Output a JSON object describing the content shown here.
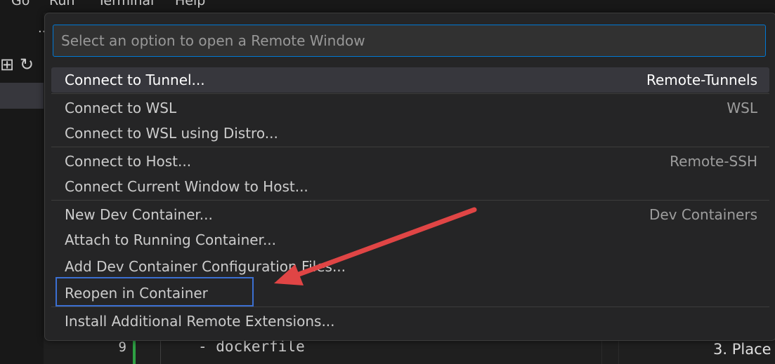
{
  "menu_bar": {
    "items": [
      "Go",
      "Run",
      "Terminal",
      "Help"
    ]
  },
  "sidebar": {
    "more": "...",
    "new_file_icon": "⊞",
    "refresh_icon": "↻"
  },
  "editor": {
    "line_number": "9",
    "code": "- dockerfile",
    "preview_text": "3. Place "
  },
  "quick_pick": {
    "placeholder": "Select an option to open a Remote Window",
    "items": [
      {
        "label": "Connect to Tunnel...",
        "group": "Remote-Tunnels",
        "active": true
      },
      {
        "label": "Connect to WSL",
        "group": "WSL"
      },
      {
        "label": "Connect to WSL using Distro...",
        "group": ""
      },
      {
        "label": "Connect to Host...",
        "group": "Remote-SSH"
      },
      {
        "label": "Connect Current Window to Host...",
        "group": ""
      },
      {
        "label": "New Dev Container...",
        "group": "Dev Containers"
      },
      {
        "label": "Attach to Running Container...",
        "group": ""
      },
      {
        "label": "Add Dev Container Configuration Files...",
        "group": ""
      },
      {
        "label": "Reopen in Container",
        "group": ""
      },
      {
        "label": "Install Additional Remote Extensions...",
        "group": ""
      }
    ]
  },
  "annotation": {
    "highlight_color": "#3b6fd1",
    "arrow_color": "#e04545"
  }
}
